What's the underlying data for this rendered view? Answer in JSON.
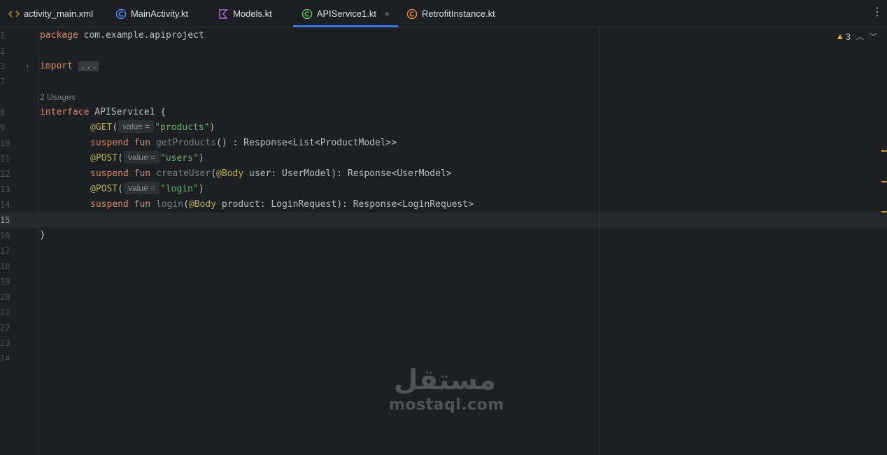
{
  "tabs": [
    {
      "label": "activity_main.xml",
      "icon": "xml-icon",
      "color": "#c88b3a",
      "active": false
    },
    {
      "label": "MainActivity.kt",
      "icon": "kotlin-class-icon",
      "color": "#548af7",
      "active": false
    },
    {
      "label": "Models.kt",
      "icon": "kotlin-file-icon",
      "color": "#9f6bd6",
      "active": false
    },
    {
      "label": "APIService1.kt",
      "icon": "kotlin-interface-icon",
      "color": "#5fb865",
      "active": true
    },
    {
      "label": "RetrofitInstance.kt",
      "icon": "kotlin-object-icon",
      "color": "#e0884c",
      "active": false
    }
  ],
  "tab_close": "×",
  "more_menu": "⋮",
  "warnings": {
    "count": "3"
  },
  "usages": "2 Usages",
  "lines": {
    "n1": "1",
    "n2": "2",
    "n3": "3",
    "n7": "7",
    "n8": "8",
    "n9": "9",
    "n10": "10",
    "n11": "11",
    "n12": "12",
    "n13": "13",
    "n14": "14",
    "n15": "15",
    "n16": "16",
    "n17": "17",
    "n18": "18",
    "n19": "19",
    "n20": "20",
    "n21": "21",
    "n22": "22",
    "n23": "23",
    "n24": "24"
  },
  "code": {
    "package_kw": "package",
    "package_name": " com.example.apiproject",
    "import_kw": "import",
    "import_fold": "...",
    "interface_kw": "interface",
    "interface_rest": " APIService1 {",
    "get_ann": "@GET",
    "post_ann": "@POST",
    "open_paren": "(",
    "hint": "value =",
    "products_str": "\"products\"",
    "users_str": "\"users\"",
    "login_str": "\"login\"",
    "close_paren": ")",
    "suspend_kw": "suspend",
    "fun_kw": "fun",
    "getProducts": "getProducts",
    "getProducts_rest": "() : Response<List<ProductModel>>",
    "createUser": "createUser",
    "body_ann": "@Body",
    "createUser_rest": " user: UserModel): Response<UserModel>",
    "login": "login",
    "login_rest": " product: LoginRequest): Response<LoginRequest>",
    "closing_brace": "}"
  },
  "watermark": {
    "arabic": "مستقل",
    "latin": "mostaql.com"
  }
}
